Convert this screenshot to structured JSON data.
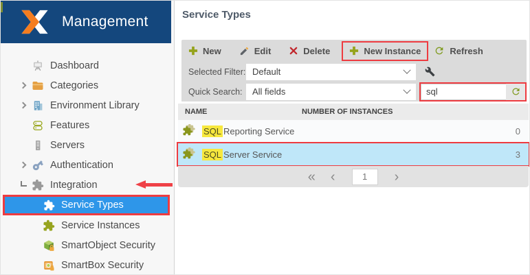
{
  "app": {
    "title": "Management"
  },
  "sidebar": {
    "items": [
      {
        "label": "Dashboard"
      },
      {
        "label": "Categories"
      },
      {
        "label": "Environment Library"
      },
      {
        "label": "Features"
      },
      {
        "label": "Servers"
      },
      {
        "label": "Authentication"
      },
      {
        "label": "Integration"
      },
      {
        "label": "Service Types"
      },
      {
        "label": "Service Instances"
      },
      {
        "label": "SmartObject Security"
      },
      {
        "label": "SmartBox Security"
      }
    ]
  },
  "main": {
    "title": "Service Types",
    "toolbar": {
      "new_label": "New",
      "edit_label": "Edit",
      "delete_label": "Delete",
      "new_instance_label": "New Instance",
      "refresh_label": "Refresh"
    },
    "filters": {
      "selected_filter_label": "Selected Filter:",
      "selected_filter_value": "Default",
      "quick_search_label": "Quick Search:",
      "quick_search_field_value": "All fields",
      "search_value": "sql"
    },
    "table": {
      "columns": {
        "name": "NAME",
        "instances": "NUMBER OF INSTANCES"
      },
      "rows": [
        {
          "highlight": "SQL",
          "name": "Reporting Service",
          "instances": "0"
        },
        {
          "highlight": "SQL",
          "name": "Server Service",
          "instances": "3"
        }
      ]
    },
    "pagination": {
      "first": "«",
      "prev": "‹",
      "page": "1",
      "next": "›"
    }
  },
  "colors": {
    "brand_navy": "#14477d",
    "selection_blue": "#2e96e9",
    "annotation_red": "#ee3b40",
    "olive_green": "#95a31c",
    "highlight_yellow": "#f7e83e",
    "selected_row_blue": "#bfe7f9"
  }
}
